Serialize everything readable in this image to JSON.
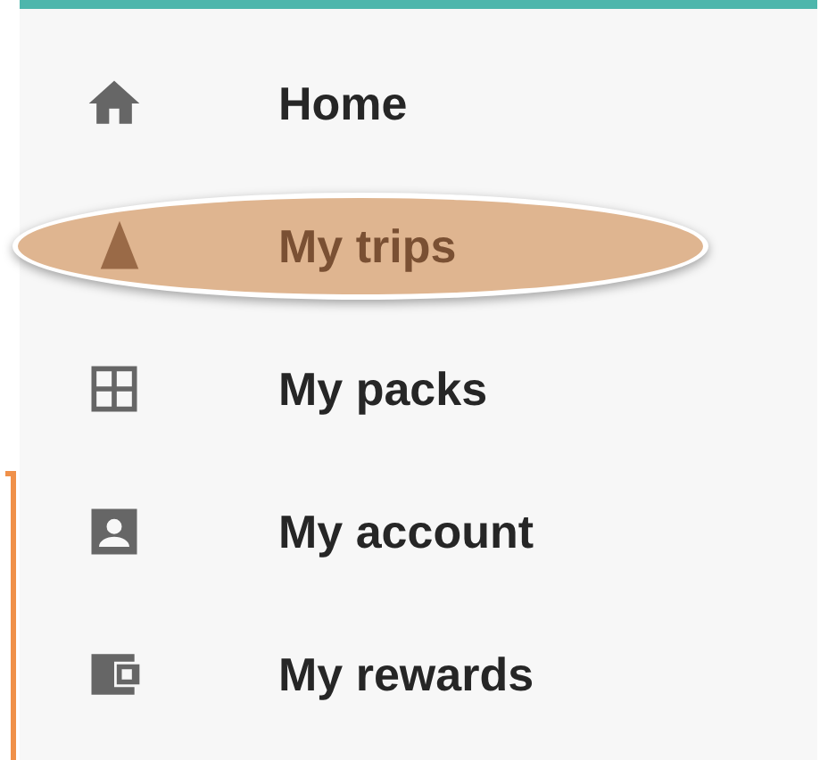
{
  "drawer": {
    "items": [
      {
        "label": "Home",
        "selected": false
      },
      {
        "label": "My trips",
        "selected": true
      },
      {
        "label": "My packs",
        "selected": false
      },
      {
        "label": "My account",
        "selected": false
      },
      {
        "label": "My rewards",
        "selected": false
      }
    ]
  }
}
